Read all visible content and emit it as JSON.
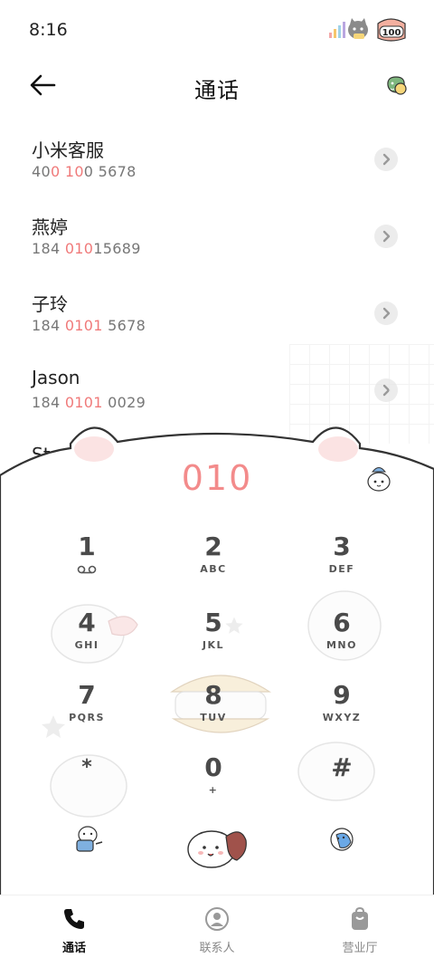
{
  "status_bar": {
    "time": "8:16",
    "battery": "100"
  },
  "header": {
    "title": "通话"
  },
  "contacts": [
    {
      "name": "小米客服",
      "num_parts": [
        "40",
        "0 10",
        "0 5678"
      ]
    },
    {
      "name": "燕婷",
      "num_parts": [
        "184 ",
        "010",
        "15689"
      ]
    },
    {
      "name": "子玲",
      "num_parts": [
        "184 ",
        "0101",
        " 5678"
      ]
    },
    {
      "name": "Jason",
      "num_parts": [
        "184 ",
        "0101",
        " 0029"
      ]
    },
    {
      "name": "Ste"
    }
  ],
  "dialer": {
    "digits": "010",
    "keys": [
      {
        "num": "1",
        "sub": ""
      },
      {
        "num": "2",
        "sub": "ABC"
      },
      {
        "num": "3",
        "sub": "DEF"
      },
      {
        "num": "4",
        "sub": "GHI"
      },
      {
        "num": "5",
        "sub": "JKL"
      },
      {
        "num": "6",
        "sub": "MNO"
      },
      {
        "num": "7",
        "sub": "PQRS"
      },
      {
        "num": "8",
        "sub": "TUV"
      },
      {
        "num": "9",
        "sub": "WXYZ"
      },
      {
        "num": "*",
        "sub": ""
      },
      {
        "num": "0",
        "sub": "+"
      },
      {
        "num": "#",
        "sub": ""
      }
    ]
  },
  "bottom_nav": [
    {
      "label": "通话",
      "icon": "phone-icon",
      "active": true
    },
    {
      "label": "联系人",
      "icon": "person-icon",
      "active": false
    },
    {
      "label": "营业厅",
      "icon": "bag-icon",
      "active": false
    }
  ],
  "colors": {
    "accent": "#f38b8b",
    "highlight": "#f07a7a",
    "key_text": "#4a4a4a"
  }
}
